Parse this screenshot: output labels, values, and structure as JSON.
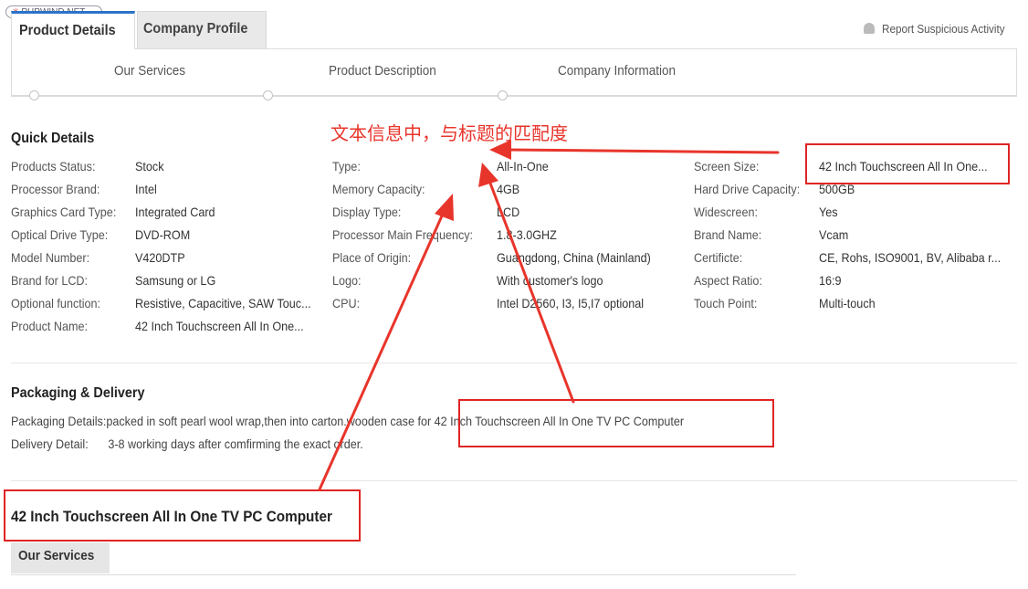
{
  "watermark": "PHPWIND.NET",
  "tabs": {
    "product_details": "Product Details",
    "company_profile": "Company Profile"
  },
  "report": "Report Suspicious Activity",
  "subnav": {
    "our_services": "Our Services",
    "product_description": "Product Description",
    "company_information": "Company Information"
  },
  "quick_details": {
    "title": "Quick Details",
    "col1": [
      {
        "label": "Products Status:",
        "value": "Stock"
      },
      {
        "label": "Processor Brand:",
        "value": "Intel"
      },
      {
        "label": "Graphics Card Type:",
        "value": "Integrated Card"
      },
      {
        "label": "Optical Drive Type:",
        "value": "DVD-ROM"
      },
      {
        "label": "Model Number:",
        "value": "V420DTP"
      },
      {
        "label": "Brand for LCD:",
        "value": "Samsung or LG"
      },
      {
        "label": "Optional function:",
        "value": "Resistive, Capacitive, SAW Touc..."
      },
      {
        "label": "Product Name:",
        "value": "42 Inch Touchscreen All In One..."
      }
    ],
    "col2": [
      {
        "label": "Type:",
        "value": "All-In-One"
      },
      {
        "label": "Memory Capacity:",
        "value": "4GB"
      },
      {
        "label": "Display Type:",
        "value": "LCD"
      },
      {
        "label": "Processor Main Frequency:",
        "value": "1.8-3.0GHZ"
      },
      {
        "label": "Place of Origin:",
        "value": "Guangdong, China (Mainland)"
      },
      {
        "label": "Logo:",
        "value": "With customer's logo"
      },
      {
        "label": "CPU:",
        "value": "Intel D2560, I3, I5,I7 optional"
      }
    ],
    "col3": [
      {
        "label": "Screen Size:",
        "value": "42 Inch Touchscreen All In One..."
      },
      {
        "label": "Hard Drive Capacity:",
        "value": "500GB"
      },
      {
        "label": "Widescreen:",
        "value": "Yes"
      },
      {
        "label": "Brand Name:",
        "value": "Vcam"
      },
      {
        "label": "Certificte:",
        "value": "CE, Rohs, ISO9001, BV, Alibaba r..."
      },
      {
        "label": "Aspect Ratio:",
        "value": "16:9"
      },
      {
        "label": "Touch Point:",
        "value": "Multi-touch"
      }
    ]
  },
  "packaging": {
    "title": "Packaging & Delivery",
    "details_label": "Packaging Details:",
    "details_value": "packed in soft pearl wool wrap,then into carton.wooden case for 42 Inch Touchscreen All In One TV PC Computer",
    "delivery_label": "Delivery Detail:",
    "delivery_value": "3-8 working days after comfirming the exact order."
  },
  "product_title": "42 Inch Touchscreen All In One TV PC Computer",
  "bottom_tab": "Our Services",
  "annotation": {
    "text": "文本信息中，与标题的匹配度",
    "color": "#e8352b"
  }
}
